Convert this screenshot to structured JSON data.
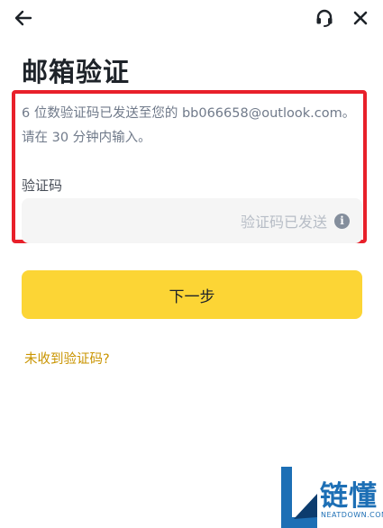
{
  "header": {
    "back_icon": "arrow-left-icon",
    "support_icon": "headset-icon",
    "close_icon": "close-icon"
  },
  "page": {
    "title": "邮箱验证"
  },
  "verification": {
    "description_line1": "6 位数验证码已发送至您的 bb066658@outlook.com。",
    "description_line2": "请在 30 分钟内输入。",
    "code_label": "验证码",
    "code_status": "验证码已发送",
    "info_icon": "info-icon"
  },
  "actions": {
    "next_label": "下一步",
    "resend_label": "未收到验证码?"
  },
  "watermark": {
    "text": "链懂",
    "subtext": "NEATDOWN.COM"
  },
  "colors": {
    "primary_button": "#fcd535",
    "link": "#c99400",
    "highlight_border": "#e8202a"
  }
}
